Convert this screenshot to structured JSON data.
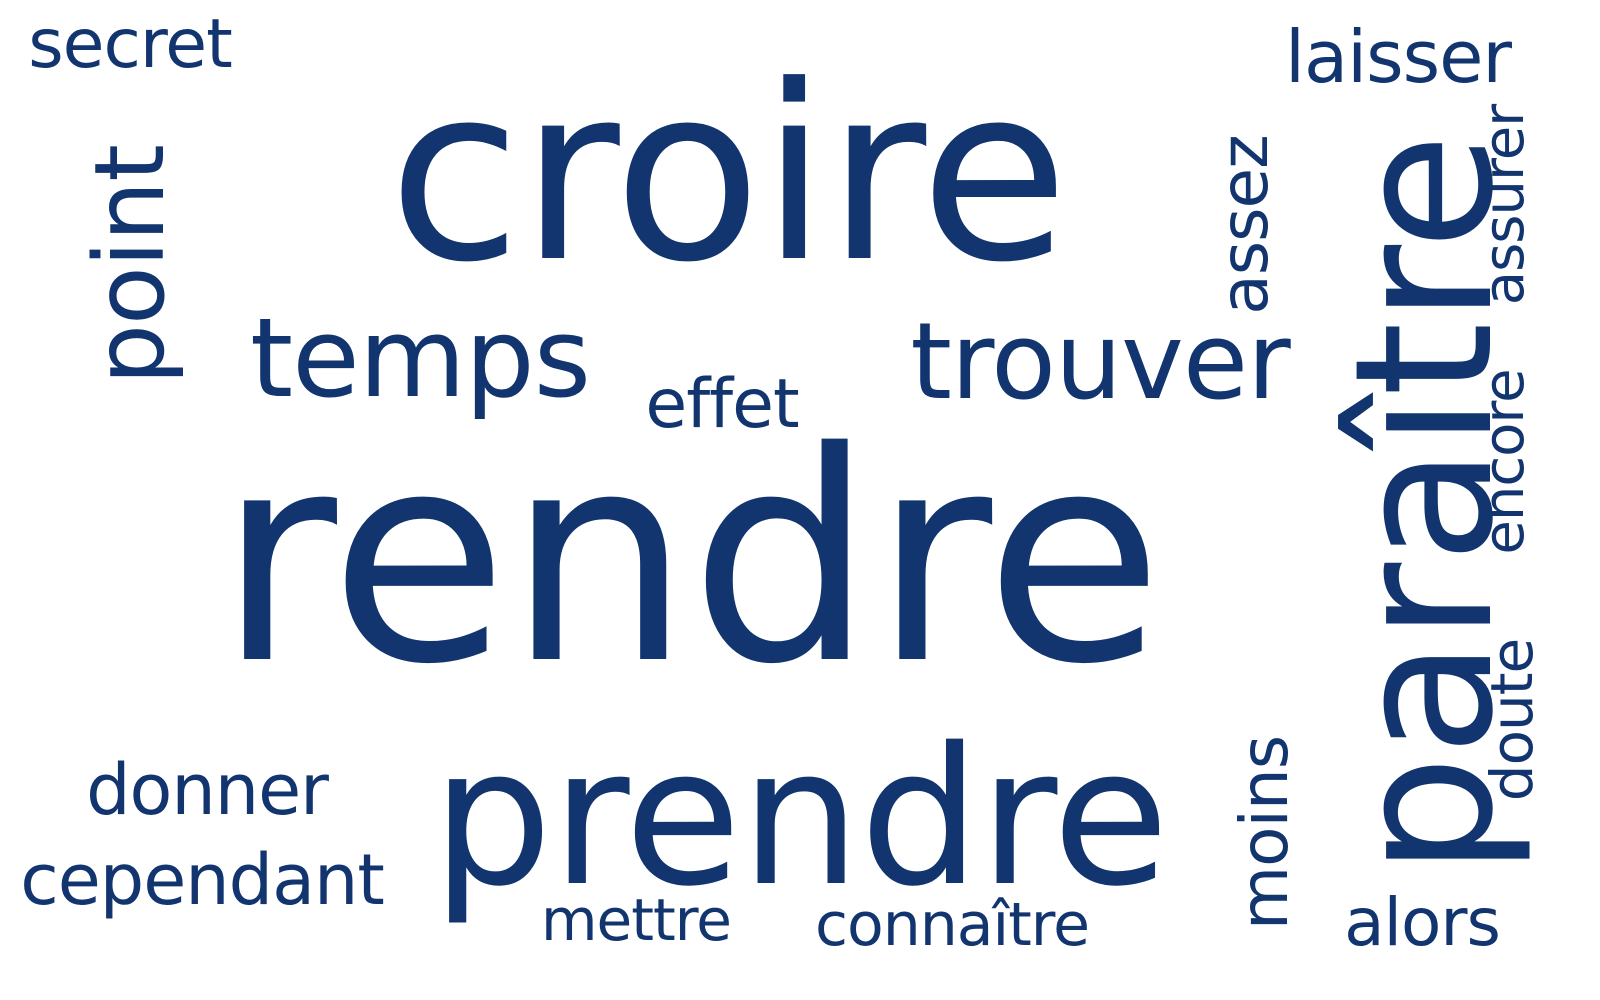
{
  "words": {
    "rendre": "rendre",
    "croire": "croire",
    "prendre": "prendre",
    "paraitre": "paraître",
    "temps": "temps",
    "trouver": "trouver",
    "point": "point",
    "secret": "secret",
    "laisser": "laisser",
    "effet": "effet",
    "assez": "assez",
    "assurer": "assurer",
    "encore": "encore",
    "doute": "doute",
    "moins": "moins",
    "alors": "alors",
    "donner": "donner",
    "cependant": "cependant",
    "mettre": "mettre",
    "connaitre": "connaître"
  },
  "colors": {
    "text": "#12356f",
    "background": "#ffffff"
  }
}
